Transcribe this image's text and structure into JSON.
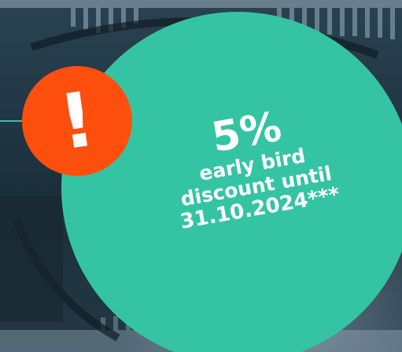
{
  "promo": {
    "percent": "5%",
    "line1": "early bird",
    "line2": "discount until",
    "line3": "31.10.2024***"
  },
  "badge": {
    "symbol": "!"
  },
  "icons": {
    "alert": "exclamation-icon"
  },
  "colors": {
    "promo_circle": "#35c4a3",
    "alert_badge": "#ff4f0f",
    "text": "#ffffff",
    "background": "#1f3340"
  }
}
